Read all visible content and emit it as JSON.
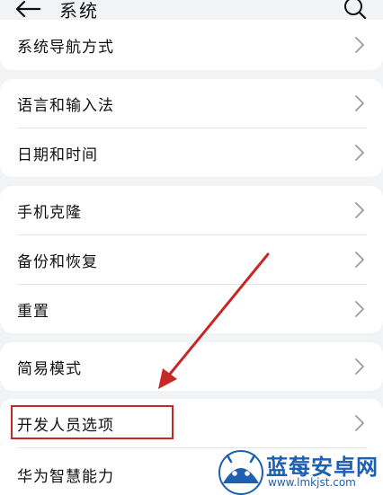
{
  "header": {
    "title": "系统"
  },
  "groups": [
    {
      "items": [
        {
          "label": "系统导航方式"
        }
      ]
    },
    {
      "items": [
        {
          "label": "语言和输入法"
        },
        {
          "label": "日期和时间"
        }
      ]
    },
    {
      "items": [
        {
          "label": "手机克隆"
        },
        {
          "label": "备份和恢复"
        },
        {
          "label": "重置"
        }
      ]
    },
    {
      "items": [
        {
          "label": "简易模式"
        }
      ]
    },
    {
      "items": [
        {
          "label": "开发人员选项"
        },
        {
          "label": "华为智慧能力"
        }
      ]
    }
  ],
  "icons": {
    "back": "arrow-left-icon",
    "search": "search-icon",
    "chevron": "chevron-right-icon"
  },
  "annotation": {
    "highlight_color": "#c62828"
  },
  "watermark": {
    "name": "蓝莓安卓网",
    "url": "www.lmkjst.com",
    "color": "#1d5fb0"
  }
}
